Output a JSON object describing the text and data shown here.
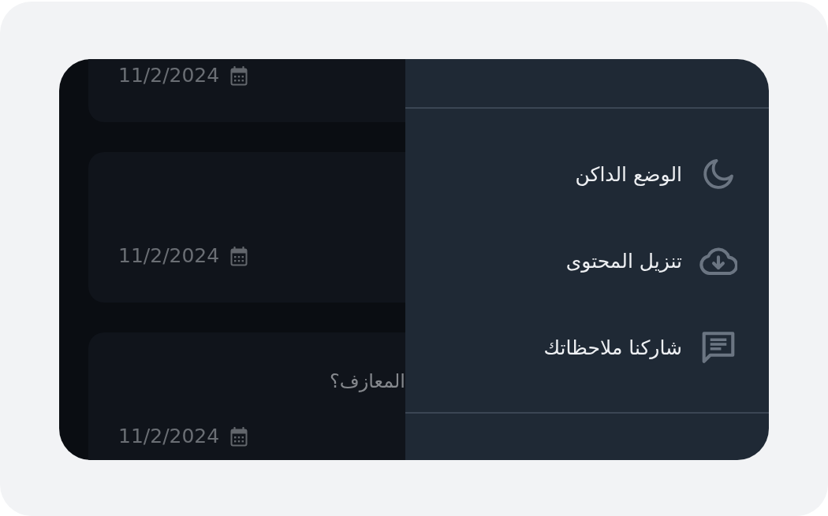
{
  "background_list": {
    "cards": [
      {
        "date": "11/2/2024"
      },
      {
        "date": "11/2/2024"
      },
      {
        "question": "المعازف؟",
        "date": "11/2/2024"
      }
    ]
  },
  "drawer": {
    "items": [
      {
        "label": "الوضع الداكن"
      },
      {
        "label": "تنزيل المحتوى"
      },
      {
        "label": "شاركنا ملاحظاتك"
      }
    ]
  }
}
